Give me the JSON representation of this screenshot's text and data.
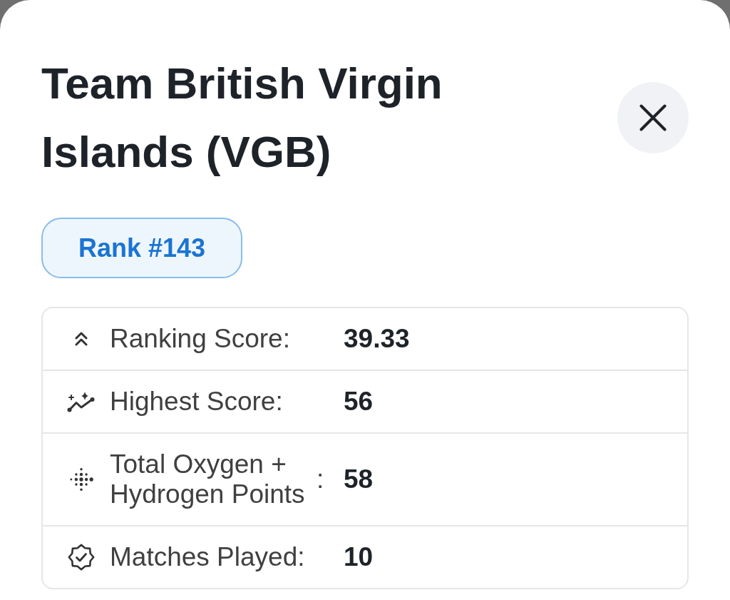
{
  "sheet": {
    "title": "Team British Virgin Islands (VGB)",
    "rank_badge": "Rank #143",
    "stats": [
      {
        "kind": "score",
        "label": "Ranking Score",
        "suffix": ":",
        "value": "39.33"
      },
      {
        "kind": "peak",
        "label": "Highest Score",
        "suffix": ":",
        "value": "56"
      },
      {
        "kind": "points",
        "label": "Total Oxygen + Hydrogen Points",
        "suffix": ":",
        "value": "58"
      },
      {
        "kind": "matches",
        "label": "Matches Played",
        "suffix": ":",
        "value": "10"
      }
    ]
  }
}
